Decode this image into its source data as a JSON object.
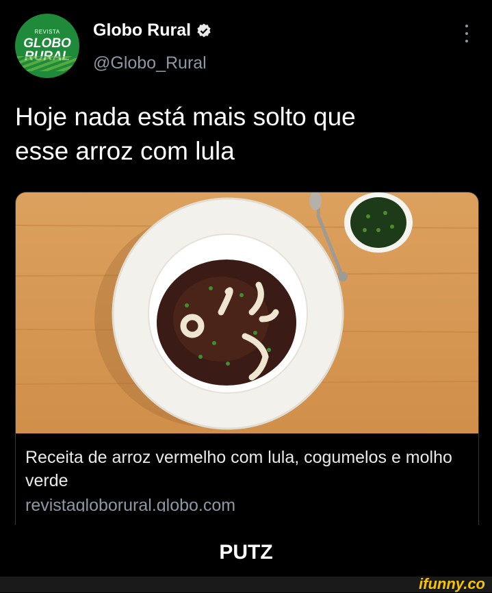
{
  "tweet": {
    "avatar": {
      "top_text": "REVISTA",
      "line1": "GLOBO",
      "line2": "RURAL"
    },
    "author_name": "Globo Rural",
    "handle": "@Globo_Rural",
    "text_line1": "Hoje nada está mais solto que",
    "text_line2": "esse arroz com lula"
  },
  "card": {
    "title": "Receita de arroz vermelho com lula, cogumelos e molho verde",
    "domain": "revistagloborural.globo.com"
  },
  "caption": "PUTZ",
  "watermark": "ifunny.co",
  "colors": {
    "verified": "#e7e9ea",
    "avatar_bg": "#1f8a3a",
    "wood": "#d99a55"
  }
}
